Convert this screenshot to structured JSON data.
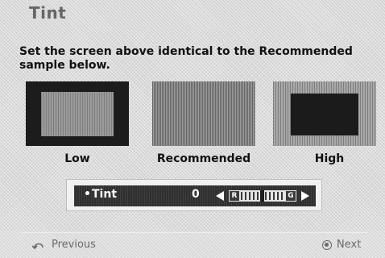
{
  "header": {
    "title": "Tint"
  },
  "instruction": "Set the screen above identical to the Recommended sample below.",
  "samples": [
    {
      "label": "Low"
    },
    {
      "label": "Recommended"
    },
    {
      "label": "High"
    }
  ],
  "tint_control": {
    "label": "Tint",
    "value": "0",
    "left_end": "R",
    "right_end": "G"
  },
  "footer": {
    "previous_label": "Previous",
    "next_label": "Next"
  },
  "icons": {
    "previous": "return-arrow-icon",
    "next": "ok-circle-icon",
    "left": "arrow-left-icon",
    "right": "arrow-right-icon"
  }
}
